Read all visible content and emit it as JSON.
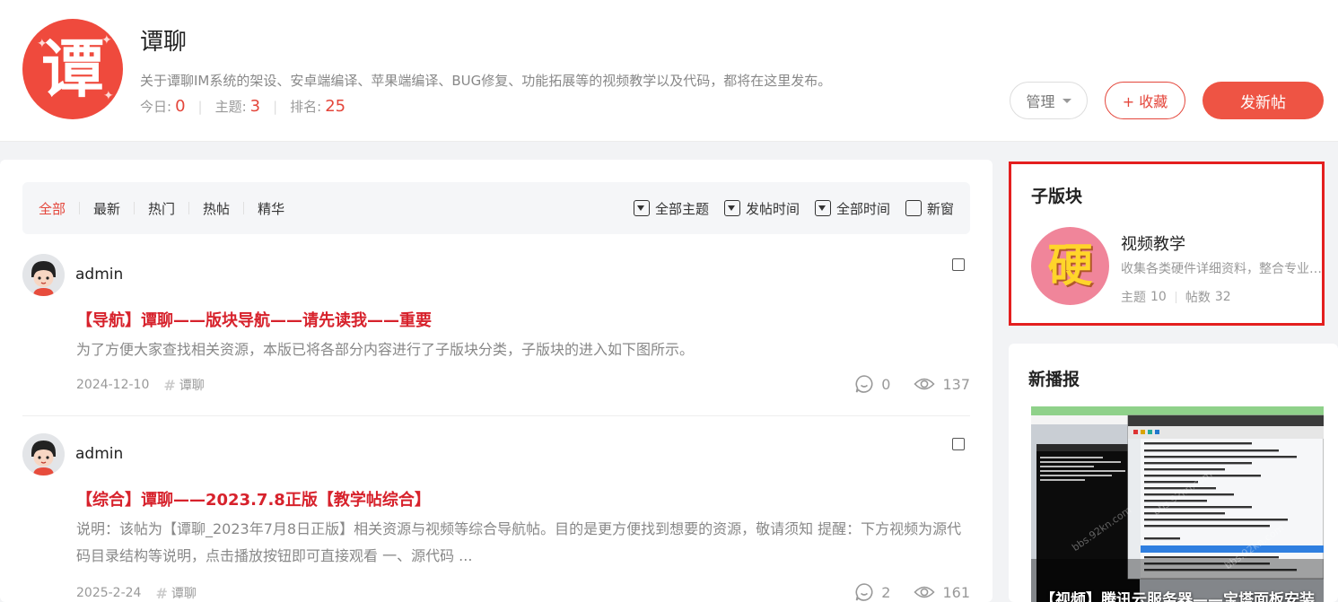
{
  "forum": {
    "logo_char": "谭",
    "title": "谭聊",
    "description": "关于谭聊IM系统的架设、安卓端编译、苹果端编译、BUG修复、功能拓展等的视频教学以及代码，都将在这里发布。",
    "stats": {
      "today_label": "今日:",
      "today_value": "0",
      "topics_label": "主题:",
      "topics_value": "3",
      "rank_label": "排名:",
      "rank_value": "25"
    },
    "buttons": {
      "manage": "管理",
      "favorite": "+ 收藏",
      "new_post": "发新帖"
    }
  },
  "filter_bar": {
    "tabs": [
      "全部",
      "最新",
      "热门",
      "热帖",
      "精华"
    ],
    "active_tab": "全部",
    "dropdowns": {
      "topic": "全部主题",
      "sort": "发帖时间",
      "time": "全部时间"
    },
    "new_window_label": "新窗"
  },
  "threads": [
    {
      "author": "admin",
      "title": "【导航】谭聊——版块导航——请先读我——重要",
      "summary": "为了方便大家查找相关资源，本版已将各部分内容进行了子版块分类，子版块的进入如下图所示。",
      "date": "2024-12-10",
      "tag": "谭聊",
      "replies": "0",
      "views": "137"
    },
    {
      "author": "admin",
      "title": "【综合】谭聊——2023.7.8正版【教学帖综合】",
      "summary": "说明：该帖为【谭聊_2023年7月8日正版】相关资源与视频等综合导航帖。目的是更方便找到想要的资源，敬请须知 提醒：下方视频为源代码目录结构等说明，点击播放按钮即可直接观看 一、源代码 ...",
      "date": "2025-2-24",
      "tag": "谭聊",
      "replies": "2",
      "views": "161"
    }
  ],
  "sidebar": {
    "subforums": {
      "title": "子版块",
      "items": [
        {
          "logo_char": "硬",
          "name": "视频教学",
          "description": "收集各类硬件详细资料，整合专业知识",
          "topics_label": "主题",
          "topics_value": "10",
          "posts_label": "帖数",
          "posts_value": "32"
        }
      ]
    },
    "news": {
      "title": "新播报",
      "caption": "【视频】腾讯云服务器——宝塔面板安装"
    }
  },
  "colors": {
    "accent": "#e4463b",
    "title_red": "#d7222c",
    "highlight_border": "#e41f1f"
  }
}
